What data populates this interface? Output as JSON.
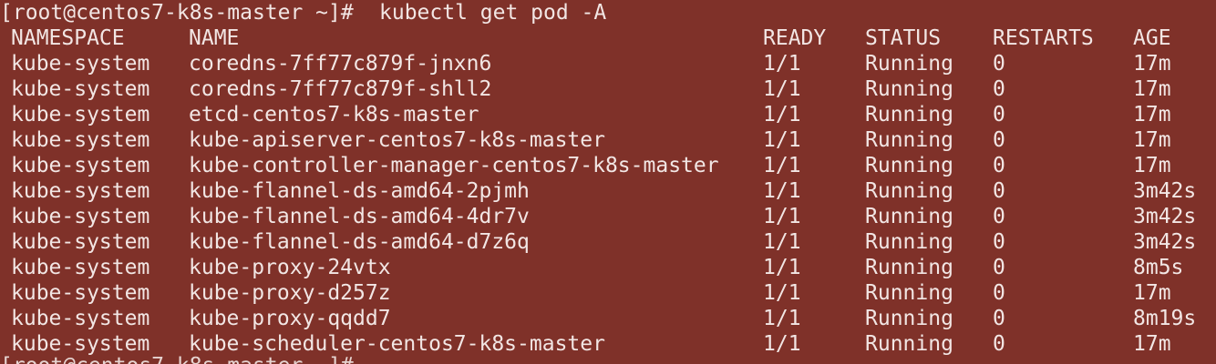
{
  "terminal": {
    "background_color": "#7f3129",
    "text_color": "#f2e6e4",
    "prompt": "[root@centos7-k8s-master ~]#",
    "command": "kubectl get pod -A",
    "bottom_prompt_partial": "[root@centos7-k8s-master ~]#"
  },
  "table": {
    "headers": {
      "namespace": "NAMESPACE",
      "name": "NAME",
      "ready": "READY",
      "status": "STATUS",
      "restarts": "RESTARTS",
      "age": "AGE"
    },
    "rows": [
      {
        "namespace": "kube-system",
        "name": "coredns-7ff77c879f-jnxn6",
        "ready": "1/1",
        "status": "Running",
        "restarts": "0",
        "age": "17m"
      },
      {
        "namespace": "kube-system",
        "name": "coredns-7ff77c879f-shll2",
        "ready": "1/1",
        "status": "Running",
        "restarts": "0",
        "age": "17m"
      },
      {
        "namespace": "kube-system",
        "name": "etcd-centos7-k8s-master",
        "ready": "1/1",
        "status": "Running",
        "restarts": "0",
        "age": "17m"
      },
      {
        "namespace": "kube-system",
        "name": "kube-apiserver-centos7-k8s-master",
        "ready": "1/1",
        "status": "Running",
        "restarts": "0",
        "age": "17m"
      },
      {
        "namespace": "kube-system",
        "name": "kube-controller-manager-centos7-k8s-master",
        "ready": "1/1",
        "status": "Running",
        "restarts": "0",
        "age": "17m"
      },
      {
        "namespace": "kube-system",
        "name": "kube-flannel-ds-amd64-2pjmh",
        "ready": "1/1",
        "status": "Running",
        "restarts": "0",
        "age": "3m42s"
      },
      {
        "namespace": "kube-system",
        "name": "kube-flannel-ds-amd64-4dr7v",
        "ready": "1/1",
        "status": "Running",
        "restarts": "0",
        "age": "3m42s"
      },
      {
        "namespace": "kube-system",
        "name": "kube-flannel-ds-amd64-d7z6q",
        "ready": "1/1",
        "status": "Running",
        "restarts": "0",
        "age": "3m42s"
      },
      {
        "namespace": "kube-system",
        "name": "kube-proxy-24vtx",
        "ready": "1/1",
        "status": "Running",
        "restarts": "0",
        "age": "8m5s"
      },
      {
        "namespace": "kube-system",
        "name": "kube-proxy-d257z",
        "ready": "1/1",
        "status": "Running",
        "restarts": "0",
        "age": "17m"
      },
      {
        "namespace": "kube-system",
        "name": "kube-proxy-qqdd7",
        "ready": "1/1",
        "status": "Running",
        "restarts": "0",
        "age": "8m19s"
      },
      {
        "namespace": "kube-system",
        "name": "kube-scheduler-centos7-k8s-master",
        "ready": "1/1",
        "status": "Running",
        "restarts": "0",
        "age": "17m"
      }
    ]
  }
}
